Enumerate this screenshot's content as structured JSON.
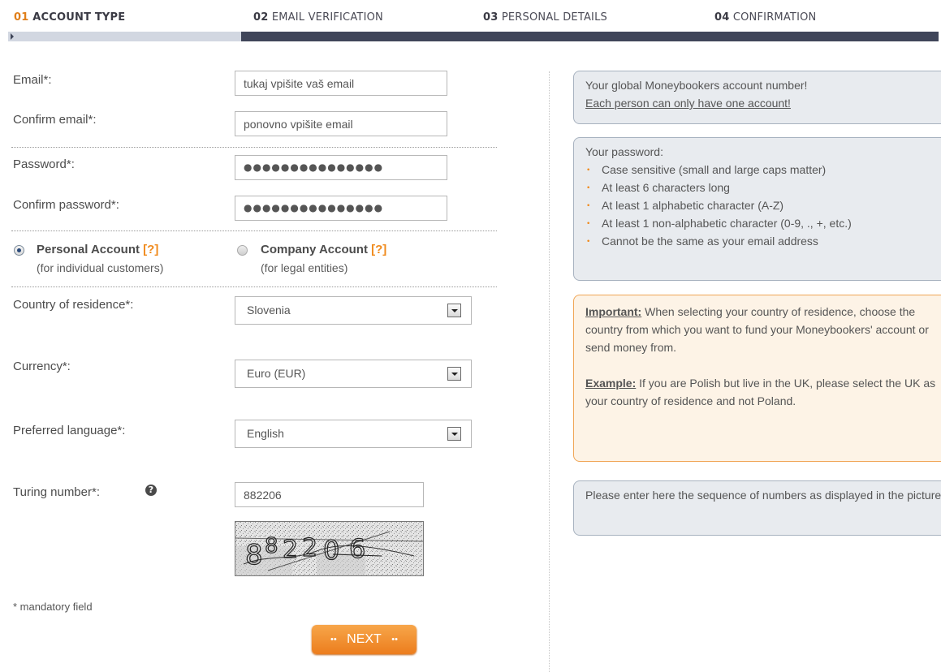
{
  "steps": [
    {
      "num": "01",
      "label": "ACCOUNT TYPE"
    },
    {
      "num": "02",
      "label": "EMAIL VERIFICATION"
    },
    {
      "num": "03",
      "label": "PERSONAL DETAILS"
    },
    {
      "num": "04",
      "label": "CONFIRMATION"
    }
  ],
  "form": {
    "email_label": "Email*:",
    "email_value": "tukaj vpišite vaš email",
    "confirm_email_label": "Confirm email*:",
    "confirm_email_value": "ponovno vpišite email",
    "password_label": "Password*:",
    "password_value": "●●●●●●●●●●●●●●●",
    "confirm_password_label": "Confirm password*:",
    "confirm_password_value": "●●●●●●●●●●●●●●●",
    "personal_account_label": "Personal Account",
    "personal_account_help": "[?]",
    "personal_account_sub": "(for individual customers)",
    "company_account_label": "Company Account",
    "company_account_help": "[?]",
    "company_account_sub": "(for legal entities)",
    "country_label": "Country of residence*:",
    "country_value": "Slovenia",
    "currency_label": "Currency*:",
    "currency_value": "Euro (EUR)",
    "language_label": "Preferred language*:",
    "language_value": "English",
    "turing_label": "Turing number*:",
    "turing_help": "?",
    "turing_value": "882206",
    "mandatory_note": "* mandatory field",
    "next_label": "NEXT"
  },
  "info": {
    "account_line1": "Your global Moneybookers account number!",
    "account_line2": "Each person can only have one account!",
    "password_title": "Your password:",
    "password_rules": [
      "Case sensitive (small and large caps matter)",
      "At least 6 characters long",
      "At least 1 alphabetic character (A-Z)",
      "At least 1 non-alphabetic character (0-9, ., +, etc.)",
      "Cannot be the same as your email address"
    ],
    "important_label": "Important:",
    "important_text": " When selecting your country of residence, choose the country from which you want to fund your Moneybookers' account or send money from.",
    "example_label": "Example:",
    "example_text": " If you are Polish but live in the UK, please select the UK as your country of residence and not Poland.",
    "turing_help_text": "Please enter here the sequence of numbers as displayed in the picture"
  },
  "colors": {
    "accent": "#f08a1c",
    "progress_dark": "#3f4559",
    "progress_light": "#d2d7e1",
    "info_bg": "#e8ebef",
    "important_bg": "#fdf3e6"
  }
}
